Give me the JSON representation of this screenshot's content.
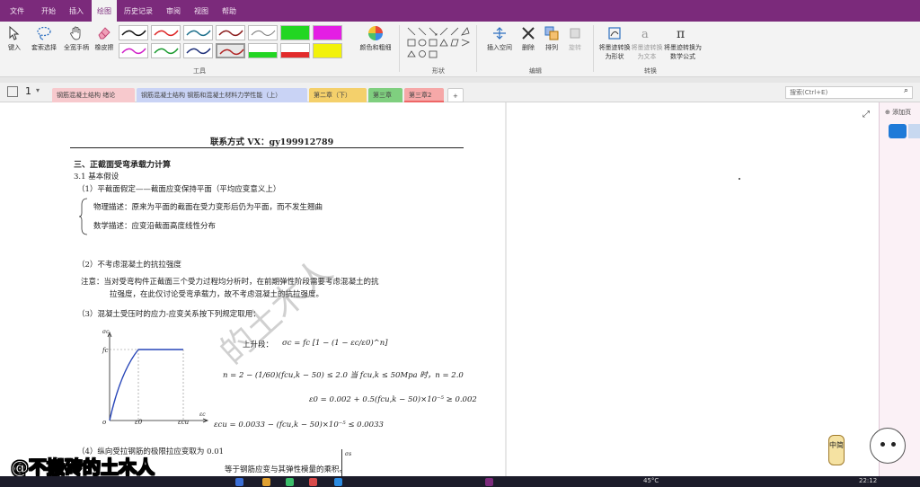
{
  "menu": {
    "file": "文件",
    "start": "开始",
    "insert": "插入",
    "draw": "绘图",
    "history": "历史记录",
    "review": "审阅",
    "view": "视图",
    "help": "帮助"
  },
  "ribbon": {
    "lasso_label": "套索选择",
    "insert_label": "键入",
    "hand_label": "全宽手柄",
    "eraser_label": "橡皮擦",
    "tools_group": "工具",
    "color_label": "颜色和粗细",
    "shapes_group": "形状",
    "insert_space": "插入空间",
    "delete": "删除",
    "arrange": "排列",
    "rotate": "旋转",
    "edit_group": "编辑",
    "ink_to_shape": "将墨迹转换为形状",
    "ink_to_text": "将墨迹转换为文本",
    "ink_to_math": "将墨迹转换为数学公式",
    "convert_group": "转换",
    "colors": {
      "accent": "#7b2a7b",
      "green": "#22d622",
      "magenta": "#e41ee4",
      "yellow": "#f2f20a",
      "red": "#e22b2b"
    }
  },
  "tabs": {
    "page_count": "1",
    "items": [
      {
        "label": "钢筋混凝土结构 绪论",
        "color": "#f7c9cd"
      },
      {
        "label": "钢筋混凝土结构 钢筋和混凝土材料力学性能（上）",
        "color": "#c9d3f5"
      },
      {
        "label": "第二章（下）",
        "color": "#f4d06b"
      },
      {
        "label": "第三章",
        "color": "#7fcf7f"
      },
      {
        "label": "第三章2",
        "color": "#f6a8a8"
      }
    ],
    "add": "+",
    "search_placeholder": "搜索(Ctrl+E)"
  },
  "doc": {
    "contact": "联系方式 VX：gy199912789",
    "section": "三、正截面受弯承载力计算",
    "sub31": "3.1  基本假设",
    "item1": "（1）平截面假定——截面应变保持平面（平均应变意义上）",
    "phys": "物理描述：原来为平面的截面在受力变形后仍为平面，而不发生翘曲",
    "math": "数学描述：应变沿截面高度线性分布",
    "item2": "（2）不考虑混凝土的抗拉强度",
    "note1": "注意：当对受弯构件正截面三个受力过程均分析时，在前期弹性阶段需要考虑混凝土的抗",
    "note2": "拉强度，在此仅讨论受弯承载力，故不考虑混凝土的抗拉强度。",
    "item3": "（3）混凝土受压时的应力-应变关系按下列规定取用：",
    "rise": "上升段：",
    "f1": "σc = fc [1 − (1 − εc/ε0)^n]",
    "f2": "n = 2 − (1/60)(fcu,k − 50) ≤ 2.0    当 fcu,k ≤ 50Mpa 时，n = 2.0",
    "f3": "ε0 = 0.002 + 0.5(fcu,k − 50)×10⁻⁵ ≥ 0.002",
    "f4": "εcu = 0.0033 − (fcu,k − 50)×10⁻⁵ ≤ 0.0033",
    "item4": "（4）纵向受拉钢筋的极限拉应变取为 0.01",
    "item5": "等于钢筋应变与其弹性模量的乘积。",
    "graph": {
      "ylabel": "σc",
      "yfc": "fc",
      "origin": "o",
      "x0": "ε0",
      "xcu": "εcu",
      "xlabel": "εc"
    },
    "graph2_label": "σs"
  },
  "right_panel": {
    "add_page": "添加页"
  },
  "watermark": "的土木人",
  "overlay": "@不搬砖的土木人",
  "mascot_text": "中简",
  "taskbar": {
    "temp": "45°C",
    "time": "22:12"
  }
}
